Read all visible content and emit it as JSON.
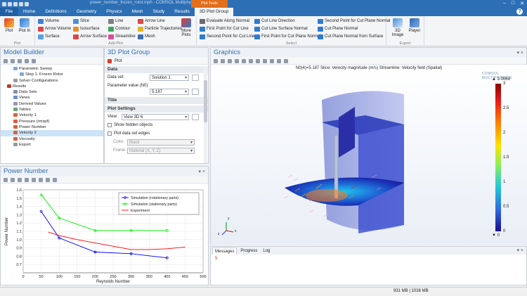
{
  "window": {
    "title": "power_number_frozen_rotor.mph - COMSOL Multiphysics",
    "context_tab": "Plot Tools"
  },
  "tabs": [
    "File",
    "Home",
    "Definitions",
    "Geometry",
    "Physics",
    "Mesh",
    "Study",
    "Results",
    "3D Plot Group"
  ],
  "ribbon": {
    "plot": {
      "plot": "Plot",
      "plot_in": "Plot In",
      "label": "Plot"
    },
    "add_plot": {
      "col1": [
        "Volume",
        "Arrow Volume",
        "Surface"
      ],
      "col2": [
        "Slice",
        "Isosurface",
        "Arrow Surface"
      ],
      "col3": [
        "Line",
        "Contour",
        "Streamline"
      ],
      "col4": [
        "Arrow Line",
        "Particle Trajectories",
        "Mesh"
      ],
      "more": "More Plots",
      "label": "Add Plot"
    },
    "select": {
      "col1": [
        "Evaluate Along Normal",
        "First Point for Cut Line",
        "Second Point for Cut Line"
      ],
      "col2": [
        "Cut Line Direction",
        "Cut Line Surface Normal",
        "First Point for Cut Plane Normal"
      ],
      "col3": [
        "Second Point for Cut Plane Normal",
        "Cut Plane Normal",
        "Cut Plane Normal from Surface"
      ],
      "label": "Select"
    },
    "export": {
      "image": "3D Image",
      "player": "Player",
      "label": "Export"
    }
  },
  "model_builder": {
    "title": "Model Builder",
    "tree": [
      {
        "label": "Parametric Sweep",
        "indent": 2
      },
      {
        "label": "Step 1: Frozen Rotor",
        "indent": 3
      },
      {
        "label": "Solver Configurations",
        "indent": 2
      },
      {
        "label": "Results",
        "indent": 1
      },
      {
        "label": "Data Sets",
        "indent": 2
      },
      {
        "label": "Views",
        "indent": 2
      },
      {
        "label": "Derived Values",
        "indent": 2
      },
      {
        "label": "Tables",
        "indent": 2
      },
      {
        "label": "Velocity 1",
        "indent": 2
      },
      {
        "label": "Pressure (rmspf)",
        "indent": 2
      },
      {
        "label": "Power Number",
        "indent": 2
      },
      {
        "label": "Velocity 2",
        "indent": 2,
        "selected": true
      },
      {
        "label": "Viscosity",
        "indent": 2
      },
      {
        "label": "Export",
        "indent": 2
      }
    ]
  },
  "plot_group": {
    "title": "3D Plot Group",
    "plot_button": "Plot",
    "data_section": "Data",
    "data_set_label": "Data set:",
    "data_set_value": "Solution 1",
    "param_label": "Parameter value (N0):",
    "param_value": "5.187",
    "title_section": "Title",
    "settings_section": "Plot Settings",
    "view_label": "View:",
    "view_value": "View 3D 6",
    "show_hidden": "Show hidden objects",
    "plot_edges": "Plot data set edges",
    "color_label": "Color:",
    "color_value": "Black",
    "frame_label": "Frame:",
    "frame_value": "Material  (X, Y, Z)"
  },
  "power_number": {
    "title": "Power Number"
  },
  "chart_data": {
    "type": "line",
    "xlabel": "Reynolds Number",
    "ylabel": "Power Number",
    "xlim": [
      0,
      500
    ],
    "ylim": [
      0.6,
      1.6
    ],
    "xticks": [
      0,
      50,
      100,
      150,
      200,
      250,
      300,
      350,
      400,
      450,
      500
    ],
    "yticks": [
      0.7,
      0.8,
      0.9,
      1.0,
      1.1,
      1.2,
      1.3,
      1.4,
      1.5,
      1.6
    ],
    "legend_position": "top-right",
    "series": [
      {
        "name": "Simulation (rotationary parts)",
        "color": "#0000ff",
        "marker": "circle",
        "x": [
          50,
          100,
          200,
          300,
          400
        ],
        "y": [
          1.34,
          1.02,
          0.85,
          0.83,
          0.78
        ]
      },
      {
        "name": "Simulation (stationary parts)",
        "color": "#00ee00",
        "marker": "circle",
        "x": [
          50,
          100,
          200,
          300,
          400
        ],
        "y": [
          1.54,
          1.26,
          1.11,
          1.11,
          1.11
        ]
      },
      {
        "name": "Experiment",
        "color": "#ff0000",
        "marker": "none",
        "x": [
          70,
          100,
          150,
          200,
          250,
          300,
          350,
          400,
          450
        ],
        "y": [
          1.09,
          1.05,
          1.0,
          0.96,
          0.92,
          0.88,
          0.88,
          0.89,
          0.91
        ]
      }
    ]
  },
  "graphics": {
    "title": "Graphics",
    "caption": "N0(4)=5.187  Slice: Velocity magnitude (m/s)  Streamline: Velocity field (Spatial)",
    "logo": "COMSOL MULTIPHYSICS",
    "colorbar_max_label": "▲ 3.0069",
    "colorbar_min_label": "▼ 0",
    "colorbar_ticks": [
      "3",
      "2.5",
      "2",
      "1.5",
      "1",
      "0.5",
      "0"
    ]
  },
  "messages": {
    "tabs": [
      "Messages",
      "Progress",
      "Log"
    ],
    "text": "5"
  },
  "status": {
    "memory": "931 MB | 1038 MB"
  }
}
